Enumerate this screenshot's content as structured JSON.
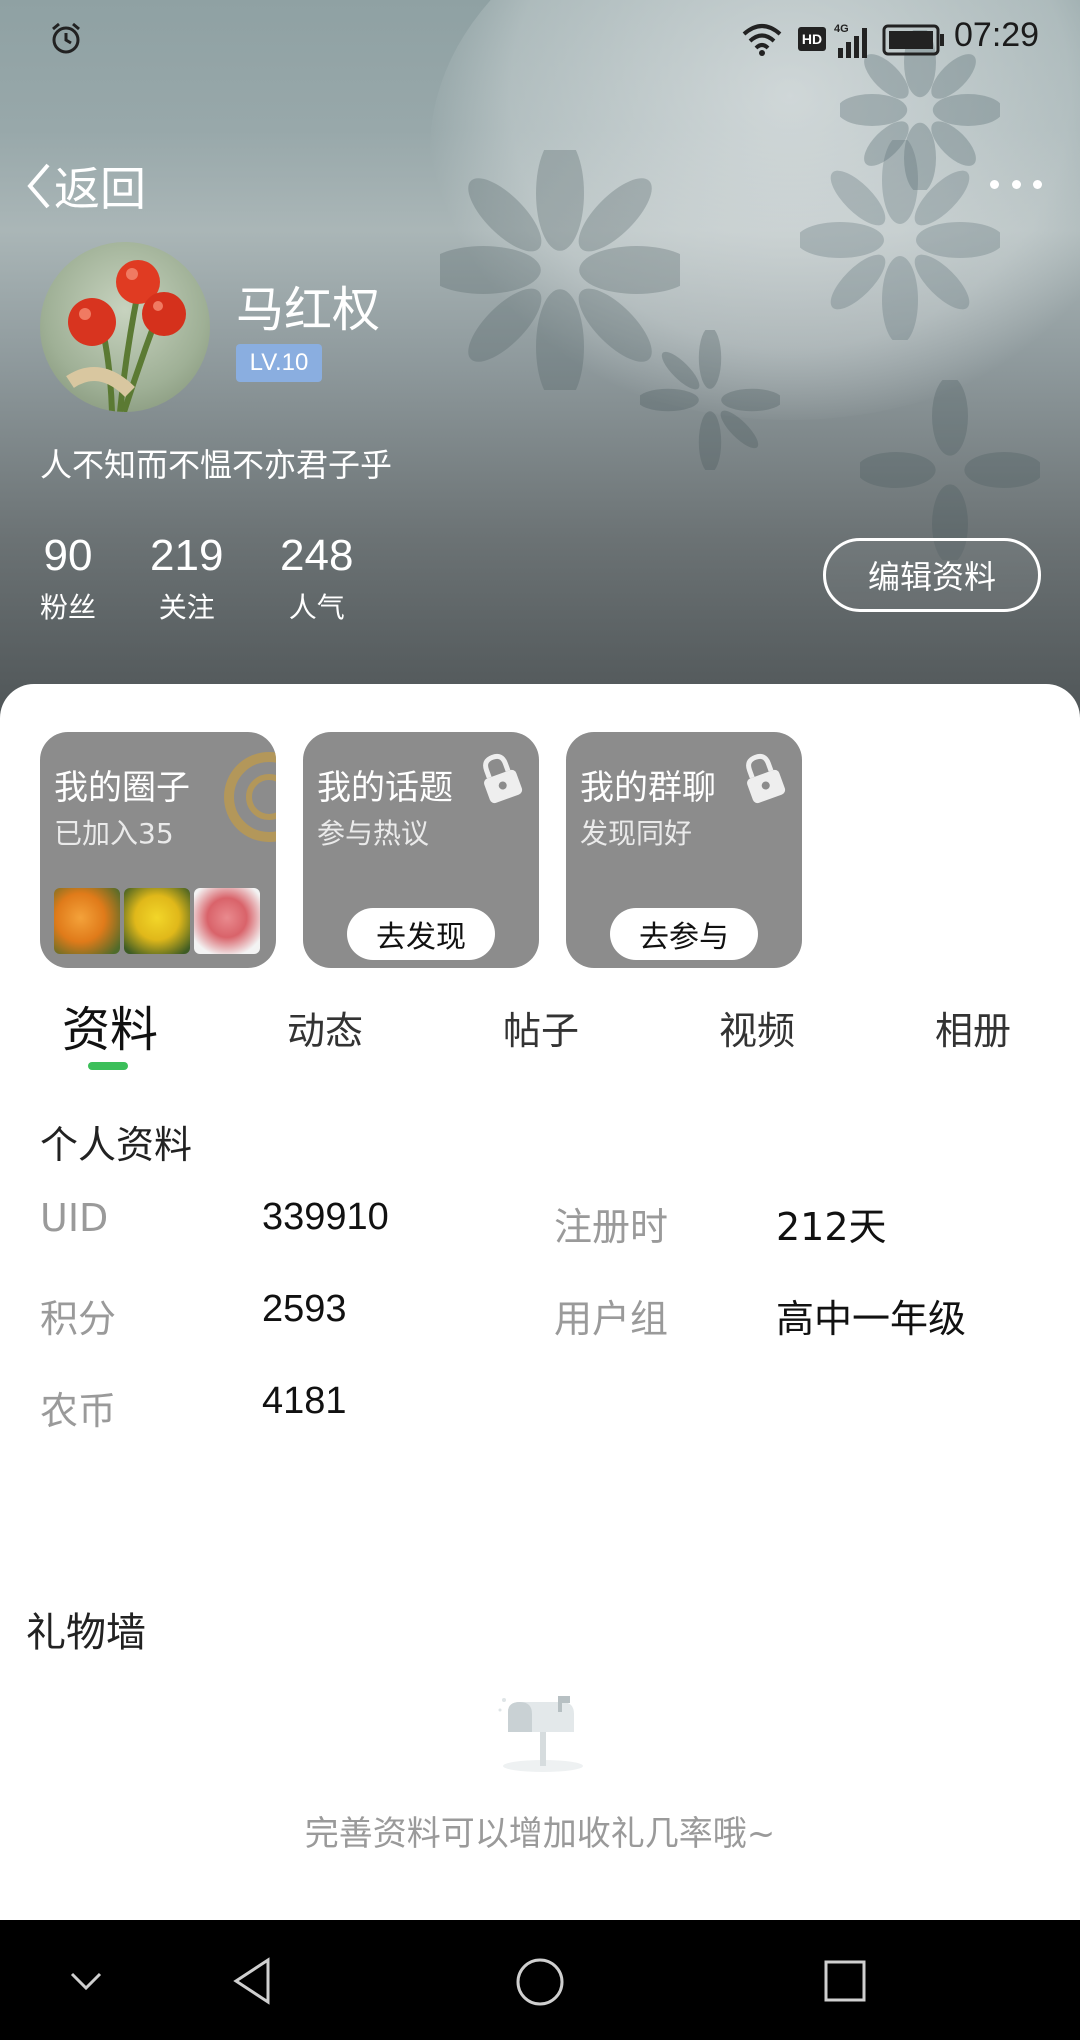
{
  "status_bar": {
    "time": "07:29",
    "hd": "HD",
    "network": "4G"
  },
  "header": {
    "back_label": "返回"
  },
  "profile": {
    "name": "马红权",
    "level": "LV.10",
    "signature": "人不知而不愠不亦君子乎",
    "stats": [
      {
        "value": "90",
        "label": "粉丝"
      },
      {
        "value": "219",
        "label": "关注"
      },
      {
        "value": "248",
        "label": "人气"
      }
    ],
    "edit_label": "编辑资料"
  },
  "cards": [
    {
      "title": "我的圈子",
      "subtitle": "已加入35"
    },
    {
      "title": "我的话题",
      "subtitle": "参与热议",
      "button": "去发现"
    },
    {
      "title": "我的群聊",
      "subtitle": "发现同好",
      "button": "去参与"
    }
  ],
  "tabs": [
    "资料",
    "动态",
    "帖子",
    "视频",
    "相册"
  ],
  "personal_info": {
    "title": "个人资料",
    "rows": [
      {
        "label": "UID",
        "value": "339910"
      },
      {
        "label": "注册时",
        "value": "212天"
      },
      {
        "label": "积分",
        "value": "2593"
      },
      {
        "label": "用户组",
        "value": "高中一年级"
      },
      {
        "label": "农币",
        "value": "4181"
      }
    ]
  },
  "gift_wall": {
    "title": "礼物墙",
    "tip": "完善资料可以增加收礼几率哦~"
  },
  "colors": {
    "accent_green": "#3cbf5a",
    "level_badge": "#8aaee0",
    "card_bg": "#8c8c8c"
  },
  "icons": [
    "alarm-icon",
    "wifi-icon",
    "signal-icon",
    "battery-icon",
    "back-chevron-icon",
    "more-icon",
    "lock-icon",
    "mailbox-icon",
    "nav-down-icon",
    "nav-back-icon",
    "nav-home-icon",
    "nav-recent-icon"
  ]
}
